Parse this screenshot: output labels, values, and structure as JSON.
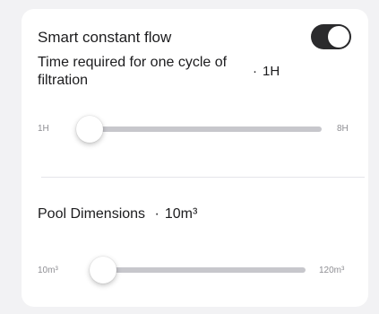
{
  "smart_flow": {
    "title": "Smart constant flow",
    "toggle_on": true
  },
  "cycle": {
    "label": "Time required for one cycle of filtration",
    "separator": "·",
    "value": "1H",
    "min_label": "1H",
    "max_label": "8H",
    "slider_fraction": 0
  },
  "pool": {
    "label": "Pool Dimensions",
    "separator": "·",
    "value": "10m³",
    "min_label": "10m³",
    "max_label": "120m³",
    "slider_fraction": 0
  },
  "colors": {
    "toggle_on": "#2b2b2d",
    "track": "#c7c7cc",
    "card": "#ffffff",
    "background": "#f2f2f4"
  }
}
